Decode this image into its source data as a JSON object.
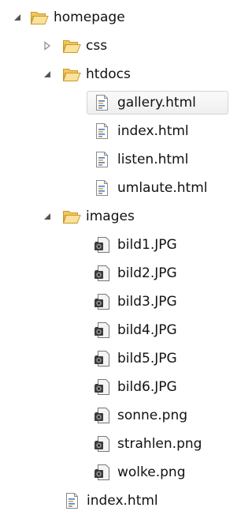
{
  "tree": {
    "root": {
      "label": "homepage",
      "expanded": true,
      "icon": "folder-open-icon"
    },
    "css": {
      "label": "css",
      "expanded": false,
      "icon": "folder-icon"
    },
    "htdocs": {
      "label": "htdocs",
      "expanded": true,
      "icon": "folder-open-icon",
      "files": [
        {
          "label": "gallery.html",
          "selected": true,
          "icon": "html-file-icon"
        },
        {
          "label": "index.html",
          "icon": "html-file-icon"
        },
        {
          "label": "listen.html",
          "icon": "html-file-icon"
        },
        {
          "label": "umlaute.html",
          "icon": "html-file-icon"
        }
      ]
    },
    "images": {
      "label": "images",
      "expanded": true,
      "icon": "folder-open-icon",
      "files": [
        {
          "label": "bild1.JPG",
          "icon": "image-file-icon"
        },
        {
          "label": "bild2.JPG",
          "icon": "image-file-icon"
        },
        {
          "label": "bild3.JPG",
          "icon": "image-file-icon"
        },
        {
          "label": "bild4.JPG",
          "icon": "image-file-icon"
        },
        {
          "label": "bild5.JPG",
          "icon": "image-file-icon"
        },
        {
          "label": "bild6.JPG",
          "icon": "image-file-icon"
        },
        {
          "label": "sonne.png",
          "icon": "image-file-icon"
        },
        {
          "label": "strahlen.png",
          "icon": "image-file-icon"
        },
        {
          "label": "wolke.png",
          "icon": "image-file-icon"
        }
      ]
    },
    "root_file": {
      "label": "index.html",
      "icon": "html-file-icon"
    }
  },
  "colors": {
    "folder_fill": "#f6d37a",
    "folder_stroke": "#c89a2a",
    "html_blue": "#4a7fc1",
    "twisty": "#555555",
    "selection_border": "#d5d5d5"
  }
}
